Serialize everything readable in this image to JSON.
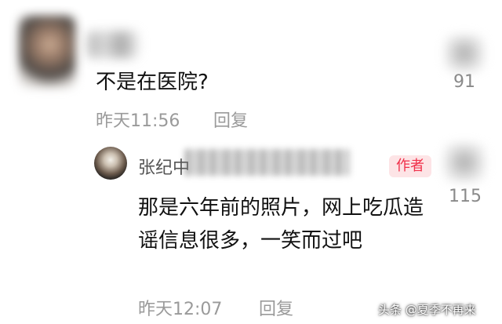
{
  "comments": [
    {
      "text": "不是在医院?",
      "time": "昨天11:56",
      "reply_label": "回复",
      "likes": "91"
    }
  ],
  "reply": {
    "author_name_visible": "张纪中",
    "badge": "作者",
    "text": "那是六年前的照片，网上吃瓜造谣信息很多，一笑而过吧",
    "time": "昨天12:07",
    "reply_label": "回复",
    "likes": "115"
  },
  "watermark": "头条 @夏季不再来",
  "colors": {
    "badge_bg": "#fde4e6",
    "badge_text": "#f0304a",
    "meta_text": "#9a9a9a"
  }
}
